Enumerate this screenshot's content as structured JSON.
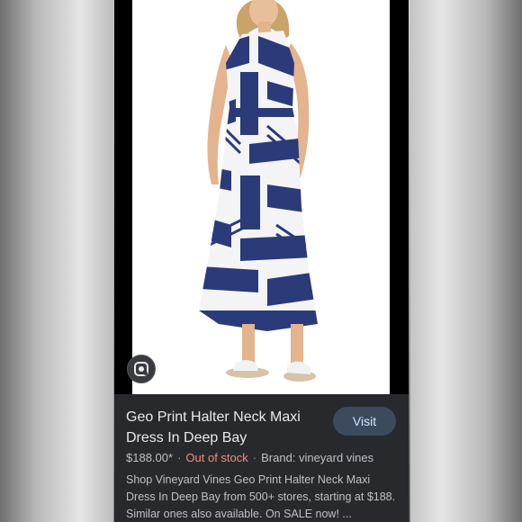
{
  "product": {
    "title": "Geo Print Halter Neck Maxi Dress In Deep Bay",
    "visit_label": "Visit",
    "price": "$188.00*",
    "separator": "·",
    "stock_status": "Out of stock",
    "brand": "Brand: vineyard vines",
    "description": "Shop Vineyard Vines Geo Print Halter Neck Maxi Dress In Deep Bay from 500+ stores, starting at $188. Similar ones also available. On SALE now! ..."
  },
  "icons": {
    "lens": "google-lens-icon"
  },
  "colors": {
    "panel_bg": "#27292d",
    "visit_bg": "#3c4a5e",
    "out_of_stock": "#f28b82",
    "dress_navy": "#2b3a78"
  }
}
